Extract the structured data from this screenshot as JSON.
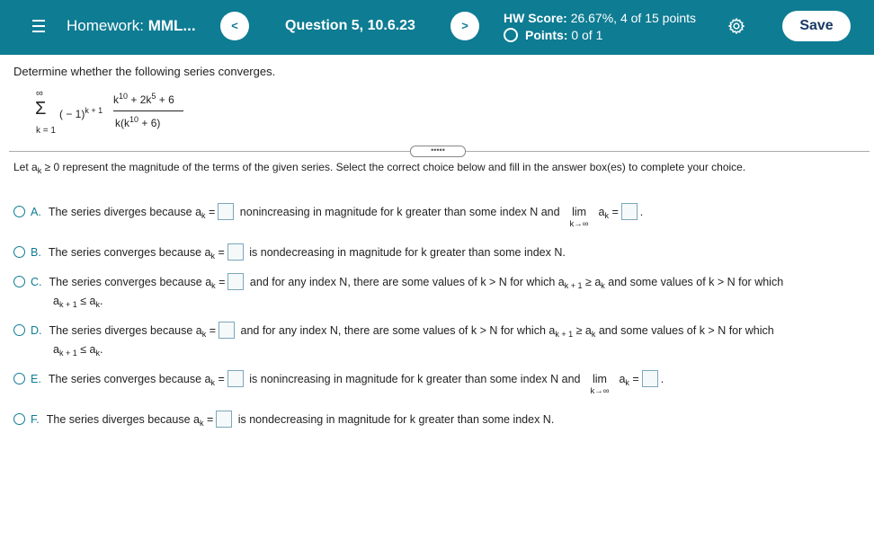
{
  "header": {
    "homework_prefix": "Homework: ",
    "homework_name": "MML...",
    "prev_label": "<",
    "question_title": "Question 5, 10.6.23",
    "next_label": ">",
    "score_label": "HW Score:",
    "score_value": "26.67%, 4 of 15 points",
    "points_label": "Points:",
    "points_value": "0 of 1",
    "save_label": "Save",
    "colors": {
      "bar": "#0e7c93",
      "save_text": "#1a3a66"
    }
  },
  "question": {
    "prompt": "Determine whether the following series converges.",
    "series": {
      "sum_top": "∞",
      "sum_symbol": "Σ",
      "sum_bottom": "k = 1",
      "factor": "( − 1)",
      "factor_exp": "k + 1",
      "num_a": "k",
      "num_a_exp": "10",
      "num_b": " + 2k",
      "num_b_exp": "5",
      "num_c": " + 6",
      "den_a": "k(k",
      "den_a_exp": "10",
      "den_b": " + 6)"
    },
    "dots": "•••••",
    "instruction": {
      "pre": "Let a",
      "sub": "k",
      "post": " ≥ 0 represent the magnitude of the terms of the given series. Select the correct choice below and fill in the answer box(es) to complete your choice."
    }
  },
  "choices": [
    {
      "letter": "A.",
      "pre": "The series diverges because a",
      "sub": "k",
      "eq": " =",
      "mid": " nonincreasing in magnitude for k greater than some index N and ",
      "lim": "lim",
      "lim_under": "k→∞",
      "lim_a": " a",
      "lim_sub": "k",
      "lim_eq": " =",
      "end": "."
    },
    {
      "letter": "B.",
      "pre": "The series converges because a",
      "sub": "k",
      "eq": " =",
      "mid": " is nondecreasing in magnitude for k greater than some index N."
    },
    {
      "letter": "C.",
      "pre": "The series converges because a",
      "sub": "k",
      "eq": " =",
      "mid": " and for any index N, there are some values of k > N for which a",
      "mid_sub": "k + 1",
      "mid2": " ≥ a",
      "mid2_sub": "k",
      "mid3": " and some values of k > N for which",
      "cont_a": "a",
      "cont_sub": "k + 1",
      "cont_rel": " ≤ a",
      "cont_sub2": "k",
      "cont_end": "."
    },
    {
      "letter": "D.",
      "pre": "The series diverges because a",
      "sub": "k",
      "eq": " =",
      "mid": " and for any index N, there are some values of k > N for which a",
      "mid_sub": "k + 1",
      "mid2": " ≥ a",
      "mid2_sub": "k",
      "mid3": " and some values of k > N for which",
      "cont_a": "a",
      "cont_sub": "k + 1",
      "cont_rel": " ≤ a",
      "cont_sub2": "k",
      "cont_end": "."
    },
    {
      "letter": "E.",
      "pre": "The series converges because a",
      "sub": "k",
      "eq": " =",
      "mid": " is nonincreasing in magnitude for k greater than some index N and ",
      "lim": "lim",
      "lim_under": "k→∞",
      "lim_a": " a",
      "lim_sub": "k",
      "lim_eq": " =",
      "end": "."
    },
    {
      "letter": "F.",
      "pre": "The series diverges because a",
      "sub": "k",
      "eq": " =",
      "mid": " is nondecreasing in magnitude for k greater than some index N."
    }
  ]
}
